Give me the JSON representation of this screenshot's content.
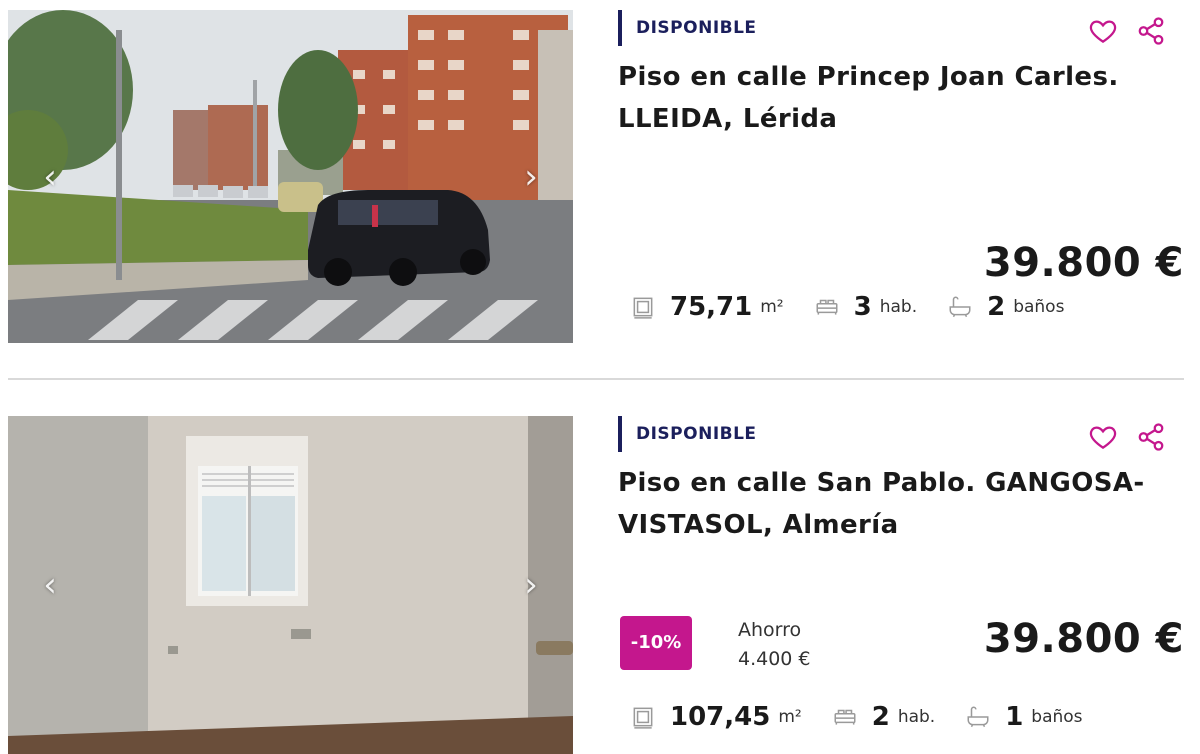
{
  "colors": {
    "brand": "#c4178d",
    "status_navy": "#1b1f5c"
  },
  "listings": [
    {
      "status": "DISPONIBLE",
      "title": "Piso en calle Princep Joan Carles. LLEIDA, Lérida",
      "price": "39.800 €",
      "features": {
        "area_value": "75,71",
        "area_unit": "m²",
        "rooms_value": "3",
        "rooms_unit": "hab.",
        "baths_value": "2",
        "baths_unit": "baños"
      },
      "icons": {
        "favorite": "heart-icon",
        "share": "share-icon",
        "prev": "chevron-left-icon",
        "next": "chevron-right-icon"
      }
    },
    {
      "status": "DISPONIBLE",
      "title": "Piso en calle San Pablo. GANGOSA-VISTASOL, Almería",
      "discount": "-10%",
      "saving_label": "Ahorro",
      "saving_amount": "4.400 €",
      "price": "39.800 €",
      "features": {
        "area_value": "107,45",
        "area_unit": "m²",
        "rooms_value": "2",
        "rooms_unit": "hab.",
        "baths_value": "1",
        "baths_unit": "baños"
      },
      "icons": {
        "favorite": "heart-icon",
        "share": "share-icon",
        "prev": "chevron-left-icon",
        "next": "chevron-right-icon"
      }
    }
  ]
}
